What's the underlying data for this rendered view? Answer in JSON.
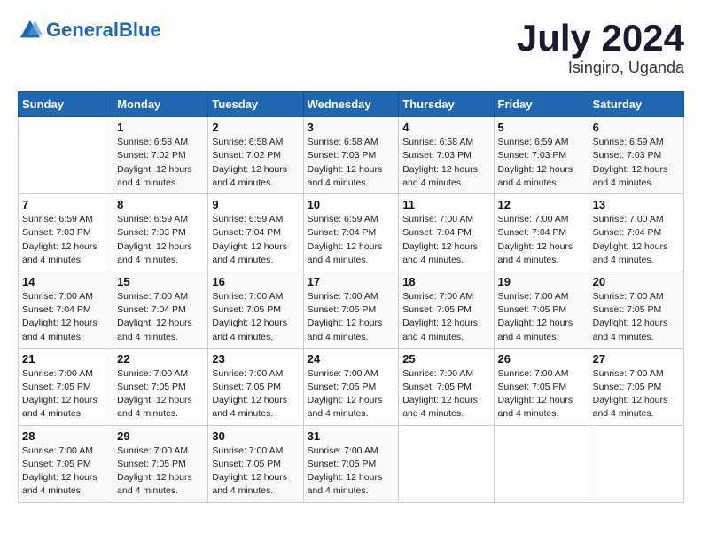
{
  "logo": {
    "text_general": "General",
    "text_blue": "Blue"
  },
  "title": "July 2024",
  "subtitle": "Isingiro, Uganda",
  "days_of_week": [
    "Sunday",
    "Monday",
    "Tuesday",
    "Wednesday",
    "Thursday",
    "Friday",
    "Saturday"
  ],
  "weeks": [
    [
      {
        "day": "",
        "sunrise": "",
        "sunset": "",
        "daylight": ""
      },
      {
        "day": "1",
        "sunrise": "Sunrise: 6:58 AM",
        "sunset": "Sunset: 7:02 PM",
        "daylight": "Daylight: 12 hours and 4 minutes."
      },
      {
        "day": "2",
        "sunrise": "Sunrise: 6:58 AM",
        "sunset": "Sunset: 7:02 PM",
        "daylight": "Daylight: 12 hours and 4 minutes."
      },
      {
        "day": "3",
        "sunrise": "Sunrise: 6:58 AM",
        "sunset": "Sunset: 7:03 PM",
        "daylight": "Daylight: 12 hours and 4 minutes."
      },
      {
        "day": "4",
        "sunrise": "Sunrise: 6:58 AM",
        "sunset": "Sunset: 7:03 PM",
        "daylight": "Daylight: 12 hours and 4 minutes."
      },
      {
        "day": "5",
        "sunrise": "Sunrise: 6:59 AM",
        "sunset": "Sunset: 7:03 PM",
        "daylight": "Daylight: 12 hours and 4 minutes."
      },
      {
        "day": "6",
        "sunrise": "Sunrise: 6:59 AM",
        "sunset": "Sunset: 7:03 PM",
        "daylight": "Daylight: 12 hours and 4 minutes."
      }
    ],
    [
      {
        "day": "7",
        "sunrise": "Sunrise: 6:59 AM",
        "sunset": "Sunset: 7:03 PM",
        "daylight": "Daylight: 12 hours and 4 minutes."
      },
      {
        "day": "8",
        "sunrise": "Sunrise: 6:59 AM",
        "sunset": "Sunset: 7:03 PM",
        "daylight": "Daylight: 12 hours and 4 minutes."
      },
      {
        "day": "9",
        "sunrise": "Sunrise: 6:59 AM",
        "sunset": "Sunset: 7:04 PM",
        "daylight": "Daylight: 12 hours and 4 minutes."
      },
      {
        "day": "10",
        "sunrise": "Sunrise: 6:59 AM",
        "sunset": "Sunset: 7:04 PM",
        "daylight": "Daylight: 12 hours and 4 minutes."
      },
      {
        "day": "11",
        "sunrise": "Sunrise: 7:00 AM",
        "sunset": "Sunset: 7:04 PM",
        "daylight": "Daylight: 12 hours and 4 minutes."
      },
      {
        "day": "12",
        "sunrise": "Sunrise: 7:00 AM",
        "sunset": "Sunset: 7:04 PM",
        "daylight": "Daylight: 12 hours and 4 minutes."
      },
      {
        "day": "13",
        "sunrise": "Sunrise: 7:00 AM",
        "sunset": "Sunset: 7:04 PM",
        "daylight": "Daylight: 12 hours and 4 minutes."
      }
    ],
    [
      {
        "day": "14",
        "sunrise": "Sunrise: 7:00 AM",
        "sunset": "Sunset: 7:04 PM",
        "daylight": "Daylight: 12 hours and 4 minutes."
      },
      {
        "day": "15",
        "sunrise": "Sunrise: 7:00 AM",
        "sunset": "Sunset: 7:04 PM",
        "daylight": "Daylight: 12 hours and 4 minutes."
      },
      {
        "day": "16",
        "sunrise": "Sunrise: 7:00 AM",
        "sunset": "Sunset: 7:05 PM",
        "daylight": "Daylight: 12 hours and 4 minutes."
      },
      {
        "day": "17",
        "sunrise": "Sunrise: 7:00 AM",
        "sunset": "Sunset: 7:05 PM",
        "daylight": "Daylight: 12 hours and 4 minutes."
      },
      {
        "day": "18",
        "sunrise": "Sunrise: 7:00 AM",
        "sunset": "Sunset: 7:05 PM",
        "daylight": "Daylight: 12 hours and 4 minutes."
      },
      {
        "day": "19",
        "sunrise": "Sunrise: 7:00 AM",
        "sunset": "Sunset: 7:05 PM",
        "daylight": "Daylight: 12 hours and 4 minutes."
      },
      {
        "day": "20",
        "sunrise": "Sunrise: 7:00 AM",
        "sunset": "Sunset: 7:05 PM",
        "daylight": "Daylight: 12 hours and 4 minutes."
      }
    ],
    [
      {
        "day": "21",
        "sunrise": "Sunrise: 7:00 AM",
        "sunset": "Sunset: 7:05 PM",
        "daylight": "Daylight: 12 hours and 4 minutes."
      },
      {
        "day": "22",
        "sunrise": "Sunrise: 7:00 AM",
        "sunset": "Sunset: 7:05 PM",
        "daylight": "Daylight: 12 hours and 4 minutes."
      },
      {
        "day": "23",
        "sunrise": "Sunrise: 7:00 AM",
        "sunset": "Sunset: 7:05 PM",
        "daylight": "Daylight: 12 hours and 4 minutes."
      },
      {
        "day": "24",
        "sunrise": "Sunrise: 7:00 AM",
        "sunset": "Sunset: 7:05 PM",
        "daylight": "Daylight: 12 hours and 4 minutes."
      },
      {
        "day": "25",
        "sunrise": "Sunrise: 7:00 AM",
        "sunset": "Sunset: 7:05 PM",
        "daylight": "Daylight: 12 hours and 4 minutes."
      },
      {
        "day": "26",
        "sunrise": "Sunrise: 7:00 AM",
        "sunset": "Sunset: 7:05 PM",
        "daylight": "Daylight: 12 hours and 4 minutes."
      },
      {
        "day": "27",
        "sunrise": "Sunrise: 7:00 AM",
        "sunset": "Sunset: 7:05 PM",
        "daylight": "Daylight: 12 hours and 4 minutes."
      }
    ],
    [
      {
        "day": "28",
        "sunrise": "Sunrise: 7:00 AM",
        "sunset": "Sunset: 7:05 PM",
        "daylight": "Daylight: 12 hours and 4 minutes."
      },
      {
        "day": "29",
        "sunrise": "Sunrise: 7:00 AM",
        "sunset": "Sunset: 7:05 PM",
        "daylight": "Daylight: 12 hours and 4 minutes."
      },
      {
        "day": "30",
        "sunrise": "Sunrise: 7:00 AM",
        "sunset": "Sunset: 7:05 PM",
        "daylight": "Daylight: 12 hours and 4 minutes."
      },
      {
        "day": "31",
        "sunrise": "Sunrise: 7:00 AM",
        "sunset": "Sunset: 7:05 PM",
        "daylight": "Daylight: 12 hours and 4 minutes."
      },
      {
        "day": "",
        "sunrise": "",
        "sunset": "",
        "daylight": ""
      },
      {
        "day": "",
        "sunrise": "",
        "sunset": "",
        "daylight": ""
      },
      {
        "day": "",
        "sunrise": "",
        "sunset": "",
        "daylight": ""
      }
    ]
  ]
}
